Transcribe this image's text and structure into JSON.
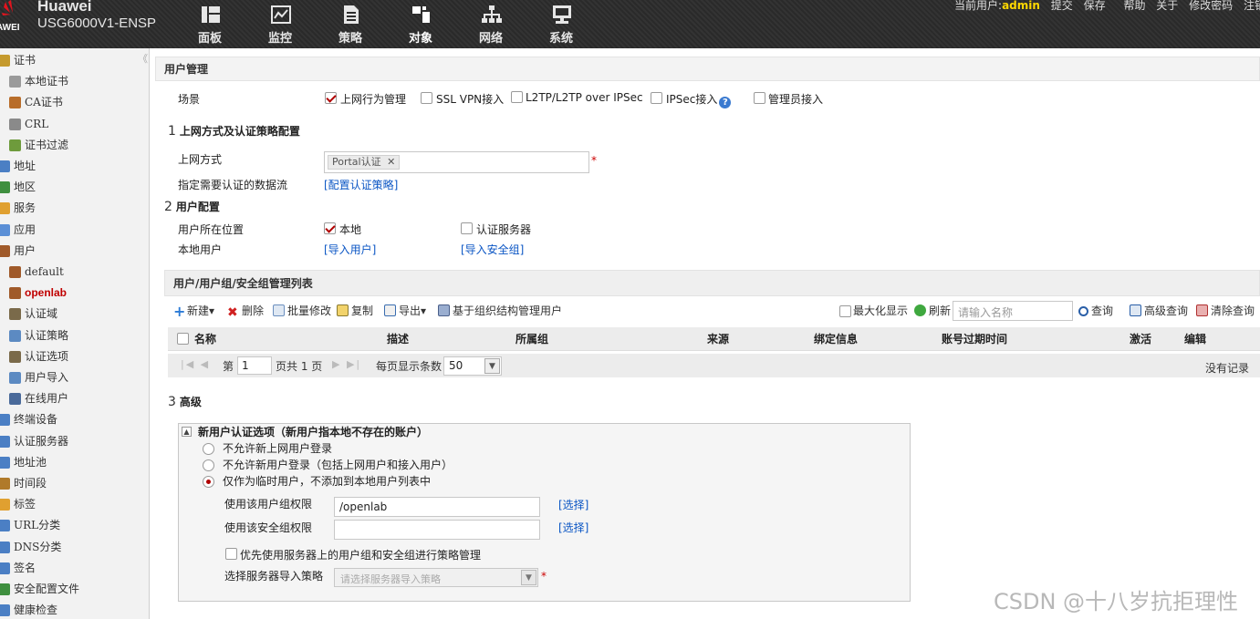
{
  "header": {
    "brand": "Huawei",
    "model": "USG6000V1-ENSP",
    "logo_sub": "AWEI",
    "nav": [
      {
        "label": "面板",
        "icon": "dashboard-icon"
      },
      {
        "label": "监控",
        "icon": "monitor-icon"
      },
      {
        "label": "策略",
        "icon": "policy-icon"
      },
      {
        "label": "对象",
        "icon": "object-icon"
      },
      {
        "label": "网络",
        "icon": "network-icon"
      },
      {
        "label": "系统",
        "icon": "system-icon"
      }
    ],
    "active_nav": "对象",
    "user_prefix": "当前用户:",
    "username": "admin",
    "links": [
      "提交",
      "保存",
      "帮助",
      "关于",
      "修改密码",
      "注销"
    ]
  },
  "sidebar": {
    "collapse": "《",
    "items": [
      {
        "label": "证书",
        "level": 0,
        "icon_color": "#c59a2e"
      },
      {
        "label": "本地证书",
        "level": 1,
        "icon_color": "#9a9a9a"
      },
      {
        "label": "CA证书",
        "level": 1,
        "icon_color": "#b86d2a"
      },
      {
        "label": "CRL",
        "level": 1,
        "icon_color": "#8a8a8a"
      },
      {
        "label": "证书过滤",
        "level": 1,
        "icon_color": "#6e9b3c"
      },
      {
        "label": "地址",
        "level": 0,
        "icon_color": "#4b7fc4"
      },
      {
        "label": "地区",
        "level": 0,
        "icon_color": "#3f8f3f"
      },
      {
        "label": "服务",
        "level": 0,
        "icon_color": "#e0a030"
      },
      {
        "label": "应用",
        "level": 0,
        "icon_color": "#5b8fd6"
      },
      {
        "label": "用户",
        "level": 0,
        "icon_color": "#a05a2a"
      },
      {
        "label": "default",
        "level": 1,
        "icon_color": "#a05a2a"
      },
      {
        "label": "openlab",
        "level": 1,
        "icon_color": "#a05a2a",
        "selected": true
      },
      {
        "label": "认证域",
        "level": 1,
        "icon_color": "#7a6a4a"
      },
      {
        "label": "认证策略",
        "level": 1,
        "icon_color": "#5c8ac2"
      },
      {
        "label": "认证选项",
        "level": 1,
        "icon_color": "#7a6a4a"
      },
      {
        "label": "用户导入",
        "level": 1,
        "icon_color": "#5c8ac2"
      },
      {
        "label": "在线用户",
        "level": 1,
        "icon_color": "#4a6a9a"
      },
      {
        "label": "终端设备",
        "level": 0,
        "icon_color": "#4b7fc4"
      },
      {
        "label": "认证服务器",
        "level": 0,
        "icon_color": "#4b7fc4"
      },
      {
        "label": "地址池",
        "level": 0,
        "icon_color": "#4b7fc4"
      },
      {
        "label": "时间段",
        "level": 0,
        "icon_color": "#b07a2a"
      },
      {
        "label": "标签",
        "level": 0,
        "icon_color": "#e0a030"
      },
      {
        "label": "URL分类",
        "level": 0,
        "icon_color": "#4b7fc4"
      },
      {
        "label": "DNS分类",
        "level": 0,
        "icon_color": "#4b7fc4"
      },
      {
        "label": "签名",
        "level": 0,
        "icon_color": "#4b7fc4"
      },
      {
        "label": "安全配置文件",
        "level": 0,
        "icon_color": "#3f8f3f"
      },
      {
        "label": "健康检查",
        "level": 0,
        "icon_color": "#4b7fc4"
      }
    ]
  },
  "main": {
    "title": "用户管理",
    "scene": {
      "label": "场景",
      "options": [
        {
          "label": "上网行为管理",
          "checked": true
        },
        {
          "label": "SSL VPN接入",
          "checked": false
        },
        {
          "label": "L2TP/L2TP over IPSec",
          "checked": false
        },
        {
          "label": "IPSec接入",
          "checked": false
        },
        {
          "label": "管理员接入",
          "checked": false
        }
      ]
    },
    "section1": {
      "num": "1",
      "title": "上网方式及认证策略配置",
      "access_label": "上网方式",
      "access_tag": "Portal认证",
      "required_star": "*",
      "flow_label": "指定需要认证的数据流",
      "flow_link": "[配置认证策略]"
    },
    "section2": {
      "num": "2",
      "title": "用户配置",
      "location_label": "用户所在位置",
      "local": {
        "label": "本地",
        "checked": true
      },
      "auth_server": {
        "label": "认证服务器",
        "checked": false
      },
      "local_user_label": "本地用户",
      "import_user": "[导入用户]",
      "import_group": "[导入安全组]"
    },
    "list": {
      "title": "用户/用户组/安全组管理列表",
      "toolbar": {
        "new": "新建▾",
        "delete": "删除",
        "batch": "批量修改",
        "copy": "复制",
        "export": "导出▾",
        "org": "基于组织结构管理用户",
        "maximize": "最大化显示",
        "refresh": "刷新",
        "search_placeholder": "请输入名称",
        "query": "查询",
        "advanced": "高级查询",
        "clear": "清除查询"
      },
      "columns": [
        "名称",
        "描述",
        "所属组",
        "来源",
        "绑定信息",
        "账号过期时间",
        "激活",
        "编辑"
      ],
      "pager": {
        "page_prefix": "第",
        "page": "1",
        "total": "页共 1 页",
        "per_page_label": "每页显示条数",
        "per_page": "50",
        "empty": "没有记录"
      }
    },
    "section3": {
      "num": "3",
      "title": "高级",
      "panel_title": "新用户认证选项（新用户指本地不存在的账户）",
      "radios": [
        {
          "label": "不允许新上网用户登录",
          "checked": false
        },
        {
          "label": "不允许新用户登录（包括上网用户和接入用户）",
          "checked": false
        },
        {
          "label": "仅作为临时用户，不添加到本地用户列表中",
          "checked": true
        }
      ],
      "group_perm_label": "使用该用户组权限",
      "group_perm_value": "/openlab",
      "sec_perm_label": "使用该安全组权限",
      "sec_perm_value": "",
      "select_link": "[选择]",
      "prefer_label": "优先使用服务器上的用户组和安全组进行策略管理",
      "import_policy_label": "选择服务器导入策略",
      "import_policy_placeholder": "请选择服务器导入策略"
    }
  },
  "watermark": "CSDN @十八岁抗拒理性"
}
